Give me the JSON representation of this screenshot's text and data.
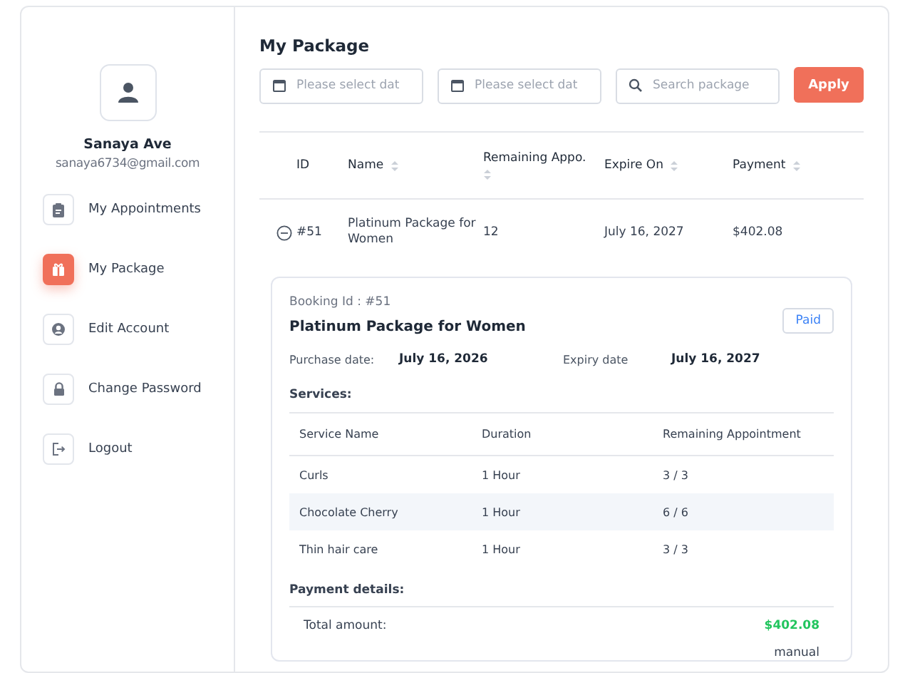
{
  "sidebar": {
    "user_name": "Sanaya Ave",
    "email": "sanaya6734@gmail.com",
    "menu": [
      {
        "label": "My Appointments",
        "selected": false
      },
      {
        "label": "My Package",
        "selected": true
      },
      {
        "label": "Edit Account",
        "selected": false
      },
      {
        "label": "Change Password",
        "selected": false
      },
      {
        "label": "Logout",
        "selected": false
      }
    ]
  },
  "main": {
    "title": "My Package",
    "filters": [
      {
        "kind": "date",
        "placeholder": "Please select dat"
      },
      {
        "kind": "date",
        "placeholder": "Please select dat"
      },
      {
        "kind": "search",
        "placeholder": "Search package"
      }
    ],
    "apply_button": "Apply",
    "table": {
      "columns": [
        {
          "label": "ID",
          "sortable": false
        },
        {
          "label": "Name",
          "sortable": true
        },
        {
          "label": "Remaining Appo.",
          "sortable": true
        },
        {
          "label": "Expire On",
          "sortable": true
        },
        {
          "label": "Payment",
          "sortable": true
        }
      ],
      "rows": [
        {
          "expanded": true,
          "id": "#51",
          "name": "Platinum Package for Women",
          "remaining": "12",
          "expire_on": "July 16, 2027",
          "payment": "$402.08",
          "details": {
            "booking_id": "Booking Id : #51",
            "title": "Platinum Package for Women",
            "status": "Paid",
            "purchase_label": "Purchase date:",
            "purchase_date": "July 16, 2026",
            "expiry_label": "Expiry date",
            "expiry_date": "July 16, 2027",
            "services_heading": "Services:",
            "services_columns": [
              "Service Name",
              "Duration",
              "Remaining Appointment"
            ],
            "services": [
              {
                "name": "Curls",
                "duration": "1 Hour",
                "remaining": "3 / 3",
                "highlighted": false
              },
              {
                "name": "Chocolate Cherry",
                "duration": "1 Hour",
                "remaining": "6 / 6",
                "highlighted": true
              },
              {
                "name": "Thin hair care",
                "duration": "1 Hour",
                "remaining": "3 / 3",
                "highlighted": false
              }
            ],
            "payment_heading": "Payment details:",
            "total_label": "Total amount:",
            "total_amount": "$402.08",
            "method": "manual"
          }
        }
      ]
    }
  }
}
